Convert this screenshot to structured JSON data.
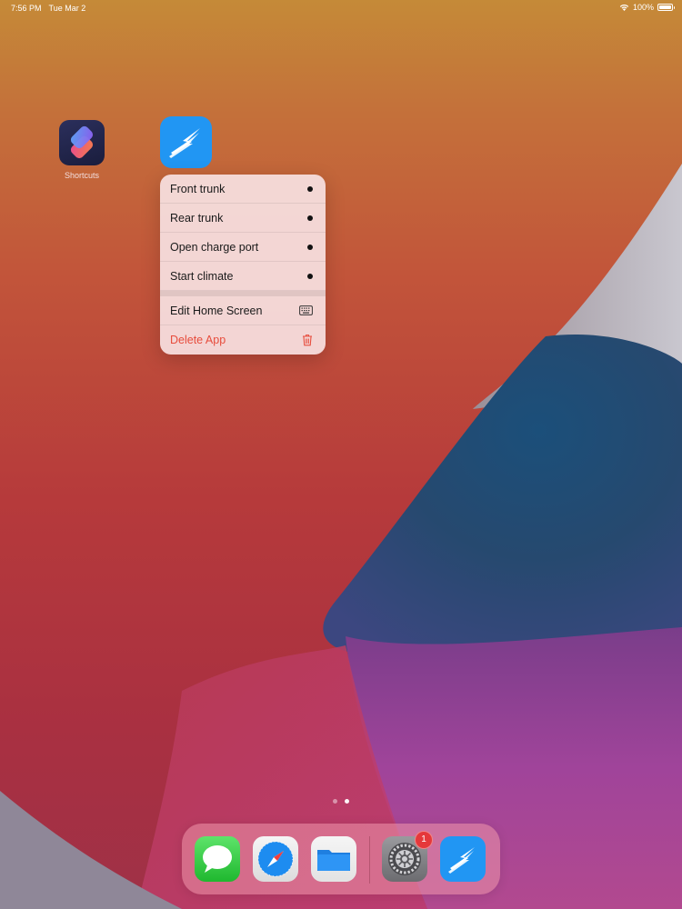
{
  "status_bar": {
    "time": "7:56 PM",
    "date": "Tue Mar 2",
    "battery_percent": "100%",
    "battery_level": 1.0
  },
  "home_apps": [
    {
      "name": "Shortcuts",
      "label": "Shortcuts",
      "icon": "shortcuts-icon"
    },
    {
      "name": "Lightning",
      "label": "",
      "icon": "lightning-bolt-icon"
    }
  ],
  "context_menu": {
    "shortcut_items": [
      {
        "label": "Front trunk",
        "icon": "dot-icon"
      },
      {
        "label": "Rear trunk",
        "icon": "dot-icon"
      },
      {
        "label": "Open charge port",
        "icon": "dot-icon"
      },
      {
        "label": "Start climate",
        "icon": "dot-icon"
      }
    ],
    "system_items": [
      {
        "label": "Edit Home Screen",
        "icon": "keyboard-icon",
        "color": "#1a1a1a"
      },
      {
        "label": "Delete App",
        "icon": "trash-icon",
        "color": "#e74c3c"
      }
    ]
  },
  "page_indicator": {
    "count": 2,
    "current": 2
  },
  "dock": {
    "apps": [
      {
        "name": "Messages",
        "icon": "messages-icon"
      },
      {
        "name": "Safari",
        "icon": "safari-compass-icon"
      },
      {
        "name": "Files",
        "icon": "files-folder-icon"
      },
      {
        "name": "Settings",
        "icon": "settings-gear-icon",
        "badge": "1"
      },
      {
        "name": "Lightning",
        "icon": "lightning-bolt-icon"
      }
    ]
  },
  "colors": {
    "accent_blue": "#2196f3",
    "danger_red": "#e74c3c",
    "badge_red": "#e5383b"
  }
}
